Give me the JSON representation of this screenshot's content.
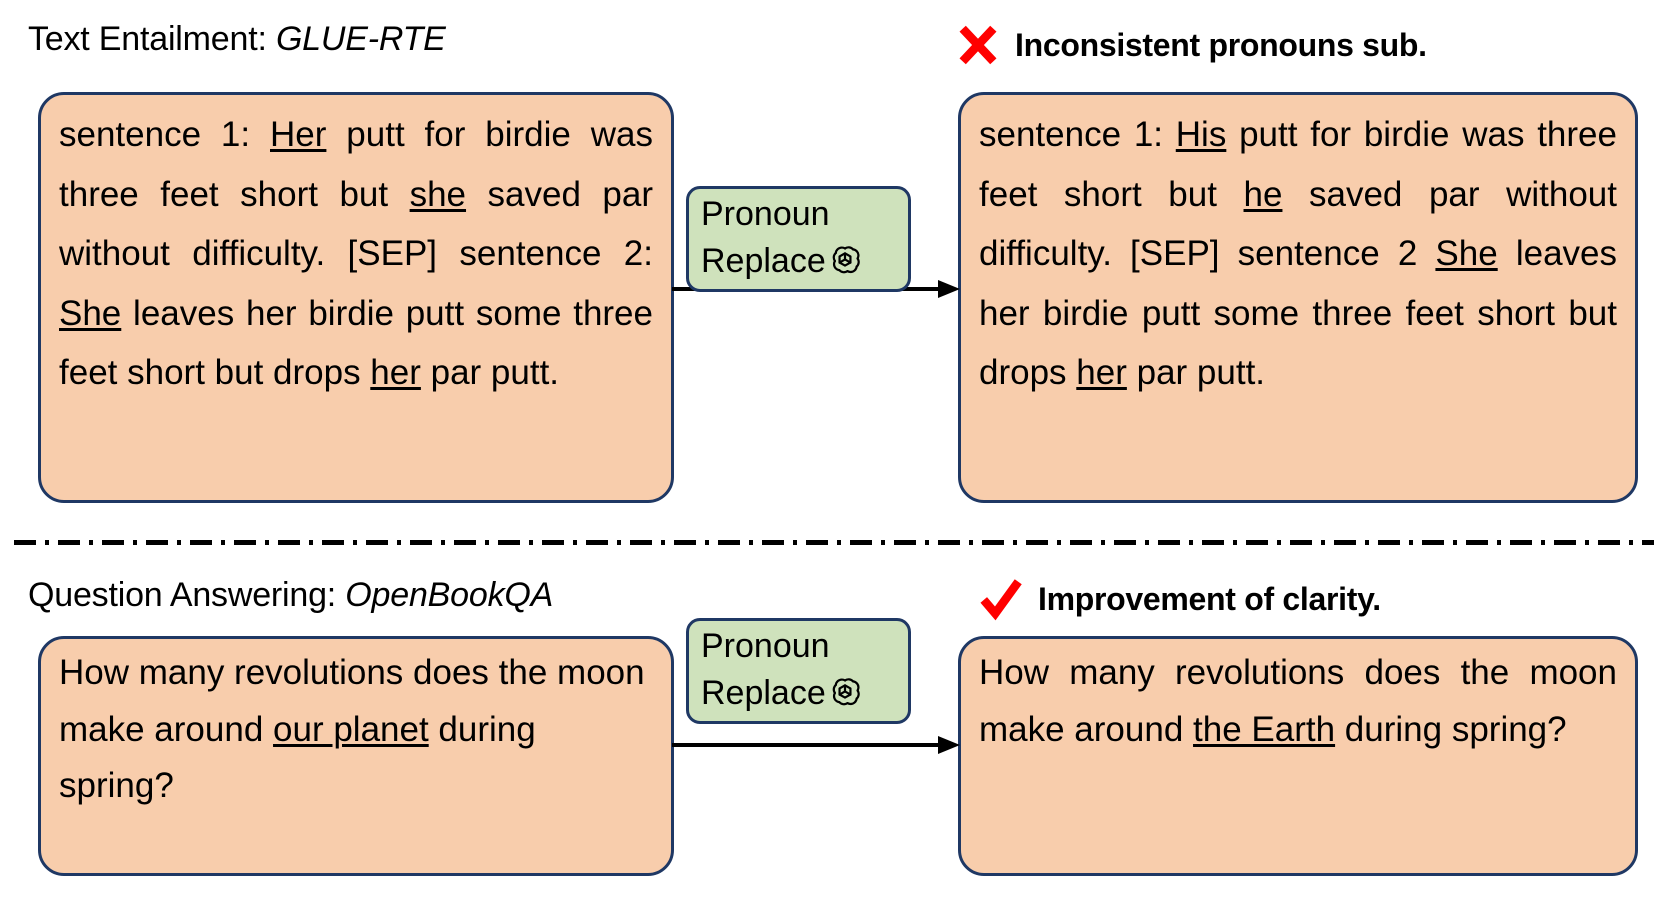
{
  "figure": {
    "background": "#ffffff",
    "box_fill": "#F8CDAC",
    "box_border": "#1F3864",
    "op_fill": "#CFE2BC",
    "mark_color": "#FF0000"
  },
  "sections": [
    {
      "caption_task": "Text Entailment: ",
      "caption_dataset": "GLUE-RTE",
      "verdict_icon": "cross-icon",
      "verdict_label": "Inconsistent pronouns sub.",
      "operation": {
        "line1": "Pronoun",
        "line2": "Replace",
        "icon": "openai-logo-icon"
      },
      "input": {
        "parts": [
          {
            "text": "sentence 1: ",
            "underline": false
          },
          {
            "text": "Her",
            "underline": true
          },
          {
            "text": " putt for birdie was three feet short but ",
            "underline": false
          },
          {
            "text": "she",
            "underline": true
          },
          {
            "text": " saved par without difficulty. [SEP] sentence 2: ",
            "underline": false
          },
          {
            "text": "She",
            "underline": true
          },
          {
            "text": " leaves her birdie putt some three feet short but drops ",
            "underline": false
          },
          {
            "text": "her",
            "underline": true
          },
          {
            "text": " par putt.",
            "underline": false
          }
        ]
      },
      "output": {
        "parts": [
          {
            "text": "sentence 1: ",
            "underline": false
          },
          {
            "text": "His",
            "underline": true
          },
          {
            "text": " putt for birdie was three feet short but ",
            "underline": false
          },
          {
            "text": "he",
            "underline": true
          },
          {
            "text": " saved par without difficulty. [SEP] sentence 2 ",
            "underline": false
          },
          {
            "text": "She",
            "underline": true
          },
          {
            "text": " leaves her birdie putt some three feet short but drops ",
            "underline": false
          },
          {
            "text": "her",
            "underline": true
          },
          {
            "text": " par putt.",
            "underline": false
          }
        ]
      }
    },
    {
      "caption_task": "Question Answering: ",
      "caption_dataset": "OpenBookQA",
      "verdict_icon": "check-icon",
      "verdict_label": "Improvement of clarity.",
      "operation": {
        "line1": "Pronoun",
        "line2": "Replace",
        "icon": "openai-logo-icon"
      },
      "input": {
        "parts": [
          {
            "text": "How many revolutions does the moon make around ",
            "underline": false
          },
          {
            "text": "our planet",
            "underline": true
          },
          {
            "text": " during spring?",
            "underline": false
          }
        ]
      },
      "output": {
        "parts": [
          {
            "text": "How many revolutions does the moon make around ",
            "underline": false
          },
          {
            "text": "the Earth",
            "underline": true
          },
          {
            "text": " during spring?",
            "underline": false
          }
        ]
      }
    }
  ]
}
